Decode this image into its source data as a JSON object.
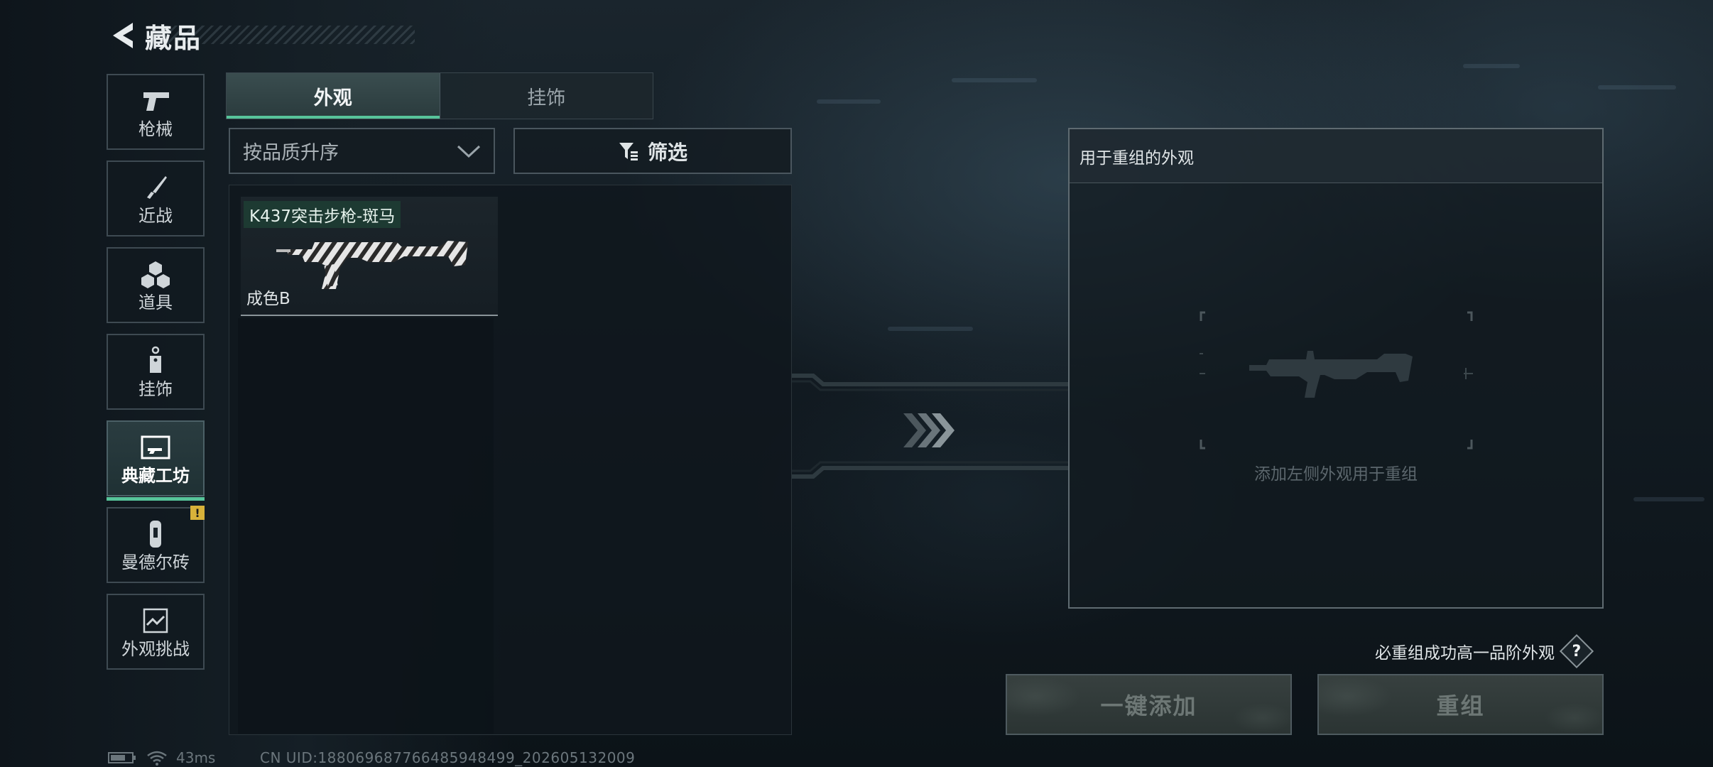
{
  "header": {
    "title": "藏品"
  },
  "sidebar": {
    "items": [
      {
        "label": "枪械"
      },
      {
        "label": "近战"
      },
      {
        "label": "道具"
      },
      {
        "label": "挂饰"
      },
      {
        "label": "典藏工坊"
      },
      {
        "label": "曼德尔砖",
        "badge": "!"
      },
      {
        "label": "外观挑战"
      }
    ],
    "active_index": 4
  },
  "tabs": [
    {
      "label": "外观"
    },
    {
      "label": "挂饰"
    }
  ],
  "sort": {
    "value": "按品质升序"
  },
  "filter": {
    "label": "筛选"
  },
  "items": [
    {
      "name": "K437突击步枪-斑马",
      "quality": "成色B"
    }
  ],
  "recombine": {
    "title": "用于重组的外观",
    "hint": "添加左侧外观用于重组",
    "guarantee": "必重组成功高一品阶外观",
    "help": "?",
    "add_all_label": "一键添加",
    "recombine_label": "重组"
  },
  "status": {
    "ping": "43ms",
    "uid": "CN UID:18806968776648594849​9_202605132009"
  },
  "colors": {
    "accent": "#57c49a",
    "badge": "#d8b23a",
    "item_name_bg": "#1d3a32"
  }
}
